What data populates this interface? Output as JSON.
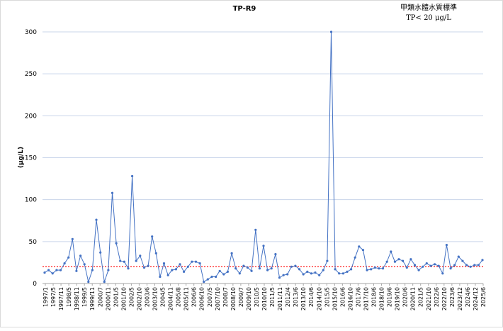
{
  "chart_data": {
    "type": "line",
    "title": "TP-R9",
    "ylabel": "(μg/L)",
    "xlabel": "",
    "ylim": [
      0,
      300
    ],
    "yticks": [
      0,
      50,
      100,
      150,
      200,
      250,
      300
    ],
    "grid": true,
    "legend": "none",
    "standard": {
      "line1": "甲類水體水質標準",
      "line2": "TP< 20 μg/L",
      "value": 20,
      "color": "#ff0000"
    },
    "series_color": "#4472c4",
    "grid_color": "#c9d5ea",
    "x_tick_labels": [
      "1997/1",
      "1997/5",
      "1997/11",
      "1998/5",
      "1998/11",
      "1999/5",
      "1999/11",
      "2000/7",
      "2000/11",
      "2001/5",
      "2001/10",
      "2002/5",
      "2002/10",
      "2003/6",
      "2003/10",
      "2004/5",
      "2004/11",
      "2005/8",
      "2005/11",
      "2006/6",
      "2006/10",
      "2007/5",
      "2007/10",
      "2008/7",
      "2008/10",
      "2009/7",
      "2009/10",
      "2010/5",
      "2010/10",
      "2011/5",
      "2011/11",
      "2012/4",
      "2013/6",
      "2013/10",
      "2014/6",
      "2014/10",
      "2015/5",
      "2015/10",
      "2016/6",
      "2016/10",
      "2017/6",
      "2017/10",
      "2018/6",
      "2018/10",
      "2019/6",
      "2019/10",
      "2020/6",
      "2020/11",
      "2021/5",
      "2021/10",
      "2022/6",
      "2022/10",
      "2023/6",
      "2023/12",
      "2024/6",
      "2024/12",
      "2025/6"
    ],
    "series": [
      {
        "values": [
          13,
          16,
          12,
          16,
          16,
          24,
          31,
          53,
          15,
          33,
          23,
          2,
          16,
          76,
          37,
          2,
          16,
          108,
          48,
          27,
          26,
          18,
          128,
          27,
          33,
          19,
          21,
          56,
          36,
          8,
          24,
          10,
          16,
          17,
          23,
          14,
          20,
          26,
          26,
          24,
          2,
          5,
          8,
          8,
          15,
          11,
          14,
          36,
          18,
          12,
          21,
          19,
          15,
          64,
          18,
          45,
          16,
          18,
          35,
          7,
          10,
          11,
          20,
          21,
          17,
          11,
          14,
          12,
          13,
          10,
          16,
          27,
          300,
          17,
          12,
          12,
          14,
          17,
          31,
          44,
          40,
          16,
          17,
          19,
          18,
          18,
          26,
          38,
          26,
          29,
          27,
          19,
          29,
          22,
          16,
          20,
          24,
          21,
          23,
          21,
          12,
          46,
          18,
          22,
          32,
          27,
          22,
          20,
          22,
          22,
          28
        ]
      }
    ]
  }
}
